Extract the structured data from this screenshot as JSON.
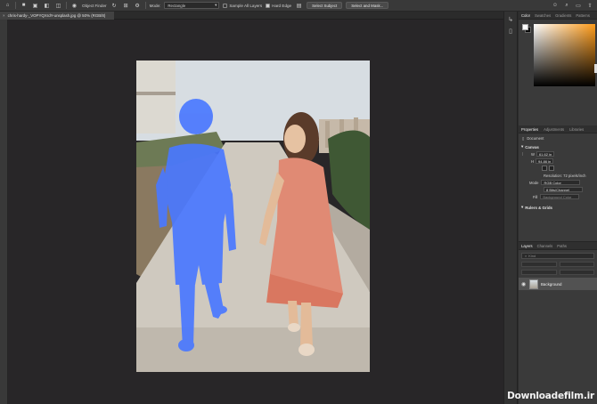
{
  "options_bar": {
    "object_finder": "Object Finder",
    "mode_label": "Mode:",
    "mode_value": "Rectangle",
    "sample_all_layers": "Sample All Layers",
    "hard_edge": "Hard Edge",
    "select_subject": "Select Subject",
    "select_and_mask": "Select and Mask..."
  },
  "document": {
    "tab_title": "chris-hardy-_VOPYQXrdY-unsplash.jpg @ 50% (RGB/8)"
  },
  "panels": {
    "color_tabs": [
      "Color",
      "Swatches",
      "Gradients",
      "Patterns"
    ],
    "props_tabs": [
      "Properties",
      "Adjustments",
      "Libraries"
    ],
    "props_document": "Document",
    "canvas_heading": "Canvas",
    "width_value": "61.62 in",
    "height_value": "94.86 in",
    "resolution": "Resolution: 72 pixels/inch",
    "mode_label": "Mode",
    "mode_value": "RGB Color",
    "bit_value": "8 Bits/Channel",
    "fill_label": "Fill",
    "fill_value": "Background Color",
    "rulers_heading": "Rulers & Grids",
    "layers_tabs": [
      "Layers",
      "Channels",
      "Paths"
    ],
    "layers_search": "Kind",
    "layer_name": "Background"
  },
  "colors": {
    "selection_overlay": "#4a78ff",
    "accent_picker": "#ff9c1a"
  },
  "watermark": "Downloadefilm.ir"
}
